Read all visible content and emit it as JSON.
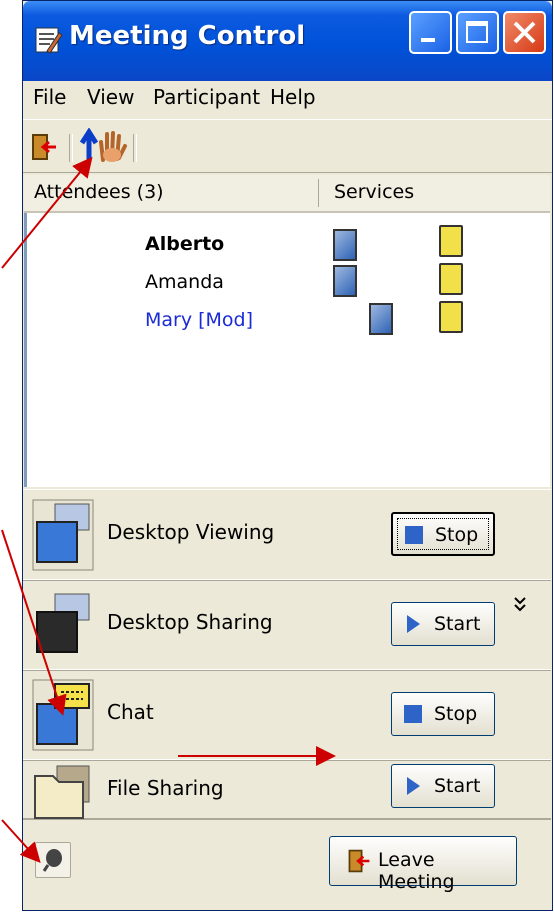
{
  "window": {
    "title": "Meeting Control",
    "controls": [
      "minimize",
      "maximize",
      "close"
    ]
  },
  "menu": [
    {
      "label": "File"
    },
    {
      "label": "View"
    },
    {
      "label": "Participant"
    },
    {
      "label": "Help"
    }
  ],
  "toolbar": {
    "buttons": [
      {
        "icon": "exit-door-icon"
      },
      {
        "icon": "raise-hand-icon"
      }
    ]
  },
  "attendees": {
    "header": "Attendees (3)",
    "services_header": "Services",
    "rows": [
      {
        "name": "Alberto",
        "bold": true,
        "color": "#000000",
        "services": [
          "desktop-icon",
          "chat-icon"
        ]
      },
      {
        "name": "Amanda",
        "bold": false,
        "color": "#000000",
        "services": [
          "desktop-icon",
          "chat-icon"
        ]
      },
      {
        "name": "Mary [Mod]",
        "bold": false,
        "color": "#1a2bd6",
        "services": [
          "desktop-share-icon",
          "chat-icon"
        ]
      }
    ]
  },
  "services": [
    {
      "name": "Desktop Viewing",
      "button": "Stop",
      "icon": "desktop-viewing-icon"
    },
    {
      "name": "Desktop Sharing",
      "button": "Start",
      "icon": "desktop-sharing-icon"
    },
    {
      "name": "Chat",
      "button": "Stop",
      "icon": "chat-icon"
    },
    {
      "name": "File Sharing",
      "button": "Start",
      "icon": "folder-icon"
    }
  ],
  "footer": {
    "leave_button": "Leave Meeting"
  },
  "colors": {
    "titlebar": "#0a47c6",
    "window_bg": "#ece9d8",
    "annotation_arrow": "#cc0000"
  }
}
